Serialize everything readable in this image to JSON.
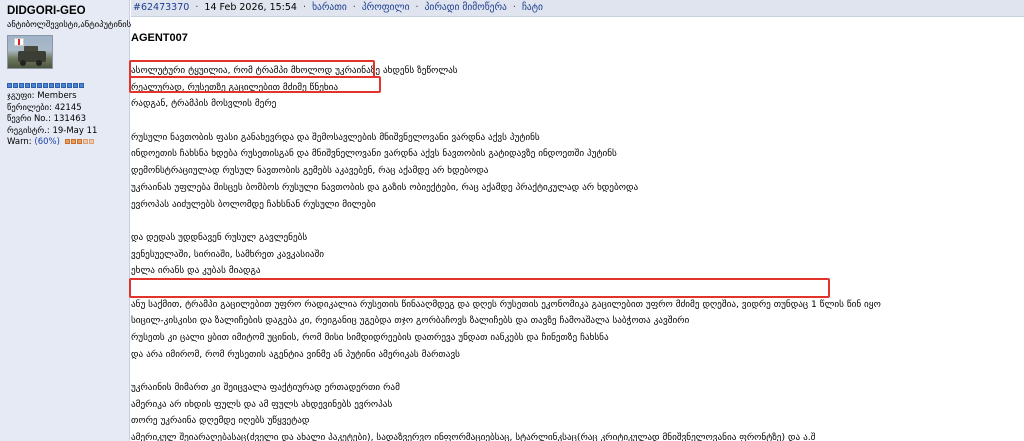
{
  "user": {
    "name": "DIDGORI-GEO",
    "title": "ანტიბოლშევისტი,ანტიპუტინისტი",
    "rank_pips": 13,
    "stats": [
      "ჯგუფი: Members",
      "წერილები: 42145",
      "წევრი No.: 131463",
      "რეგისტრ.: 19-May 11"
    ],
    "warn_label": "Warn:",
    "warn_pct": "(60%)",
    "warn_level": 0.6
  },
  "post": {
    "id": "#62473370",
    "date": "14 Feb 2026, 15:54",
    "actions": [
      "ხარათი",
      "პროფილი",
      "პირადი მიმოწერა",
      "ჩატი"
    ],
    "signature": "AGENT007",
    "lines": [
      "ასოლუტური ტყუილია, რომ ტრამპი მხოლოდ უკრაინაზე ახდენს ზეწოლას",
      "რეალურად, რუსეთზე გაცილებით მძიმე წნეხია",
      "რადგან, ტრამპის მოსვლის მერე",
      "",
      "რუსული ნავთობის ფასი განახევრდა და შემოსავლების მნიშვნელოვანი ვარდნა აქვს პუტინს",
      "ინდოეთის ჩახსნა ხდება რუსეთისგან და მნიშვნელოვანი ვარდნა აქვს ნავთობის გატიდავზე ინდოეთში პუტინს",
      "დემონსტრაციულად რუსულ ნავთობის გემებს აკავებენ, რაც აქამდე არ ხდებოდა",
      "უკრაინას უფლება მისცეს ბომბოს რუსული ნავთობის და გაზის ობიექტები, რაც აქამდე პრაქტიკულად არ ხდებოდა",
      "ევროპას აიძულებს ბოლომდე ჩახსნან რუსული მილები",
      "",
      "და დედას უდდნავენ რუსულ გავლენებს",
      "ვენესუელაში, სირიაში, სამხრეთ კავკასიაში",
      "ეხლა ირანს და კუბას მიადგა",
      "",
      "ანუ საქმით, ტრამპი გაცილებით უფრო რადიკალია რუსეთის წინააღმდეგ და დღეს რუსეთის ეკონომიკა გაცილებით უფრო მძიმე დღეშია, ვიდრე თუნდაც 1 წლის წინ იყო",
      "სიცილ-კისკისი და ზალიჩების დაგება კი, რეიგანიც უგებდა თჯო გორბაჩოვს ზალიჩებს და თავზე ჩამოაშალა საბჭოთა კავშირი",
      "რუსეთს კი ცალი ყბით იმიტომ უცინის, რომ მისი სიმდიდრეების დათრევა უნდათ იანკებს და ჩინეთზე ჩახსნა",
      "და არა იმირომ, რომ რუსეთის აგენტია ვინმე ან პუტინი ამერიკას მართავს",
      "",
      "უკრაინის მიმართ კი შეიცვალა ფაქტიურად ერთადერთი რამ",
      "ამერიკა არ იხდის ფულს და ამ ფულს ახდევინებს ევროპას",
      "თორე უკრაინა დღემდე იღებს უწყვეტად",
      "ამერიკულ შეიარაღებასაც(ძველი და ახალი პაკეტები), სადაზვერვო ინფორმაციებსაც, სტარლინკსაც(რაც კრიტიკულად მნიშვნელოვანია ფრონტზე) და ა.შ"
    ]
  },
  "colors": {
    "highlight": "#e2342a",
    "link": "#1c3d8f",
    "panel_bg": "#e6eaf4"
  }
}
